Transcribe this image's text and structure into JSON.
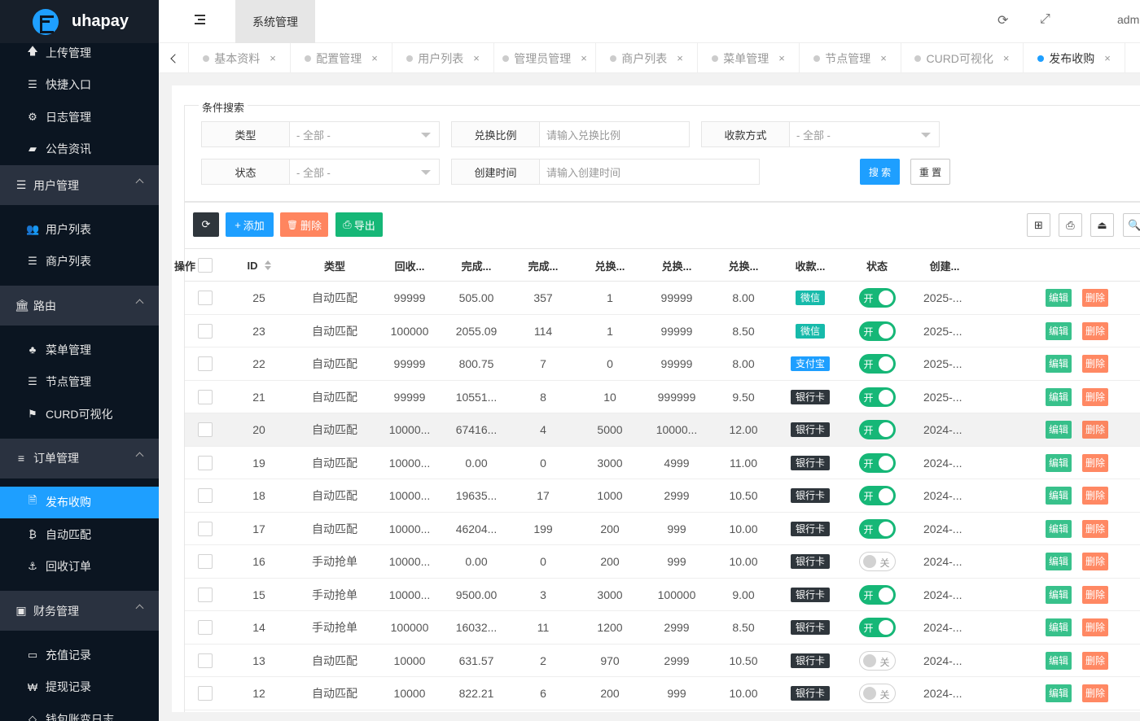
{
  "brand": {
    "name": "uhapay"
  },
  "sidebar": {
    "items_top": [
      {
        "icon": "arrow-up-icon",
        "glyph": "🡅",
        "label": "上传管理"
      },
      {
        "icon": "list-icon",
        "glyph": "☰",
        "label": "快捷入口"
      },
      {
        "icon": "cog-icon",
        "glyph": "⚙",
        "label": "日志管理"
      },
      {
        "icon": "book-icon",
        "glyph": "▰",
        "label": "公告资讯"
      }
    ],
    "groups": [
      {
        "icon": "list-icon",
        "glyph": "☰",
        "label": "用户管理",
        "items": [
          {
            "icon": "users-icon",
            "glyph": "👥",
            "label": "用户列表"
          },
          {
            "icon": "list-icon",
            "glyph": "☰",
            "label": "商户列表"
          }
        ]
      },
      {
        "icon": "bank-icon",
        "glyph": "🏛",
        "label": "路由",
        "items": [
          {
            "icon": "tree-icon",
            "glyph": "♣",
            "label": "菜单管理"
          },
          {
            "icon": "list-icon",
            "glyph": "☰",
            "label": "节点管理"
          },
          {
            "icon": "flag-icon",
            "glyph": "⚑",
            "label": "CURD可视化"
          }
        ]
      },
      {
        "icon": "bars-icon",
        "glyph": "≡",
        "label": "订单管理",
        "items": [
          {
            "icon": "file-icon",
            "glyph": "🗎",
            "label": "发布收购",
            "active": true
          },
          {
            "icon": "bitcoin-icon",
            "glyph": "₿",
            "label": "自动匹配"
          },
          {
            "icon": "anchor-icon",
            "glyph": "⚓",
            "label": "回收订单"
          }
        ]
      },
      {
        "icon": "money-icon",
        "glyph": "▣",
        "label": "财务管理",
        "items": [
          {
            "icon": "card-icon",
            "glyph": "▭",
            "label": "充值记录"
          },
          {
            "icon": "won-icon",
            "glyph": "₩",
            "label": "提现记录"
          },
          {
            "icon": "diamond-icon",
            "glyph": "◇",
            "label": "钱包账变日志"
          }
        ]
      }
    ]
  },
  "header": {
    "system_tab": "系统管理",
    "user": "adm"
  },
  "tabs": [
    {
      "label": "基本资料",
      "close": "×"
    },
    {
      "label": "配置管理",
      "close": "×"
    },
    {
      "label": "用户列表",
      "close": "×"
    },
    {
      "label": "管理员管理",
      "close": "×"
    },
    {
      "label": "商户列表",
      "close": "×"
    },
    {
      "label": "菜单管理",
      "close": "×"
    },
    {
      "label": "节点管理",
      "close": "×"
    },
    {
      "label": "CURD可视化",
      "close": "×"
    },
    {
      "label": "发布收购",
      "close": "×",
      "active": true
    }
  ],
  "search": {
    "legend": "条件搜索",
    "type": {
      "label": "类型",
      "value": "- 全部 -"
    },
    "ratio": {
      "label": "兑换比例",
      "placeholder": "请输入兑换比例"
    },
    "pay_method": {
      "label": "收款方式",
      "value": "- 全部 -"
    },
    "status": {
      "label": "状态",
      "value": "- 全部 -"
    },
    "created": {
      "label": "创建时间",
      "placeholder": "请输入创建时间"
    },
    "search_btn": "搜 索",
    "reset_btn": "重 置"
  },
  "toolbar": {
    "refresh_glyph": "⟳",
    "add": "添加",
    "add_glyph": "+",
    "delete": "删除",
    "delete_glyph": "🗑",
    "export": "导出",
    "export_glyph": "⎙",
    "right_glyphs": [
      "⊞",
      "⎙",
      "⏏",
      "🔍"
    ]
  },
  "table": {
    "columns": [
      "ID",
      "类型",
      "回收...",
      "完成...",
      "完成...",
      "兑换...",
      "兑换...",
      "兑换...",
      "收款...",
      "状态",
      "创建...",
      "操作"
    ],
    "edit_label": "编辑",
    "delete_label": "删除",
    "on_label": "开",
    "off_label": "关",
    "rows": [
      {
        "id": "25",
        "type": "自动匹配",
        "c1": "99999",
        "c2": "505.00",
        "c3": "357",
        "c4": "1",
        "c5": "99999",
        "c6": "8.00",
        "pay": "微信",
        "pay_color": "#16baaa",
        "on": true,
        "date": "2025-..."
      },
      {
        "id": "23",
        "type": "自动匹配",
        "c1": "100000",
        "c2": "2055.09",
        "c3": "114",
        "c4": "1",
        "c5": "99999",
        "c6": "8.50",
        "pay": "微信",
        "pay_color": "#16baaa",
        "on": true,
        "date": "2025-..."
      },
      {
        "id": "22",
        "type": "自动匹配",
        "c1": "99999",
        "c2": "800.75",
        "c3": "7",
        "c4": "0",
        "c5": "99999",
        "c6": "8.00",
        "pay": "支付宝",
        "pay_color": "#1e9fff",
        "on": true,
        "date": "2025-..."
      },
      {
        "id": "21",
        "type": "自动匹配",
        "c1": "99999",
        "c2": "10551...",
        "c3": "8",
        "c4": "10",
        "c5": "999999",
        "c6": "9.50",
        "pay": "银行卡",
        "pay_color": "#2f363c",
        "on": true,
        "date": "2025-..."
      },
      {
        "id": "20",
        "type": "自动匹配",
        "c1": "10000...",
        "c2": "67416...",
        "c3": "4",
        "c4": "5000",
        "c5": "10000...",
        "c6": "12.00",
        "pay": "银行卡",
        "pay_color": "#2f363c",
        "on": true,
        "date": "2024-...",
        "hl": true
      },
      {
        "id": "19",
        "type": "自动匹配",
        "c1": "10000...",
        "c2": "0.00",
        "c3": "0",
        "c4": "3000",
        "c5": "4999",
        "c6": "11.00",
        "pay": "银行卡",
        "pay_color": "#2f363c",
        "on": true,
        "date": "2024-..."
      },
      {
        "id": "18",
        "type": "自动匹配",
        "c1": "10000...",
        "c2": "19635...",
        "c3": "17",
        "c4": "1000",
        "c5": "2999",
        "c6": "10.50",
        "pay": "银行卡",
        "pay_color": "#2f363c",
        "on": true,
        "date": "2024-..."
      },
      {
        "id": "17",
        "type": "自动匹配",
        "c1": "10000...",
        "c2": "46204...",
        "c3": "199",
        "c4": "200",
        "c5": "999",
        "c6": "10.00",
        "pay": "银行卡",
        "pay_color": "#2f363c",
        "on": true,
        "date": "2024-..."
      },
      {
        "id": "16",
        "type": "手动抢单",
        "c1": "10000...",
        "c2": "0.00",
        "c3": "0",
        "c4": "200",
        "c5": "999",
        "c6": "10.00",
        "pay": "银行卡",
        "pay_color": "#2f363c",
        "on": false,
        "date": "2024-..."
      },
      {
        "id": "15",
        "type": "手动抢单",
        "c1": "10000...",
        "c2": "9500.00",
        "c3": "3",
        "c4": "3000",
        "c5": "100000",
        "c6": "9.00",
        "pay": "银行卡",
        "pay_color": "#2f363c",
        "on": true,
        "date": "2024-..."
      },
      {
        "id": "14",
        "type": "手动抢单",
        "c1": "100000",
        "c2": "16032...",
        "c3": "11",
        "c4": "1200",
        "c5": "2999",
        "c6": "8.50",
        "pay": "银行卡",
        "pay_color": "#2f363c",
        "on": true,
        "date": "2024-..."
      },
      {
        "id": "13",
        "type": "自动匹配",
        "c1": "10000",
        "c2": "631.57",
        "c3": "2",
        "c4": "970",
        "c5": "2999",
        "c6": "10.50",
        "pay": "银行卡",
        "pay_color": "#2f363c",
        "on": false,
        "date": "2024-..."
      },
      {
        "id": "12",
        "type": "自动匹配",
        "c1": "10000",
        "c2": "822.21",
        "c3": "6",
        "c4": "200",
        "c5": "999",
        "c6": "10.00",
        "pay": "银行卡",
        "pay_color": "#2f363c",
        "on": false,
        "date": "2024-..."
      }
    ]
  }
}
